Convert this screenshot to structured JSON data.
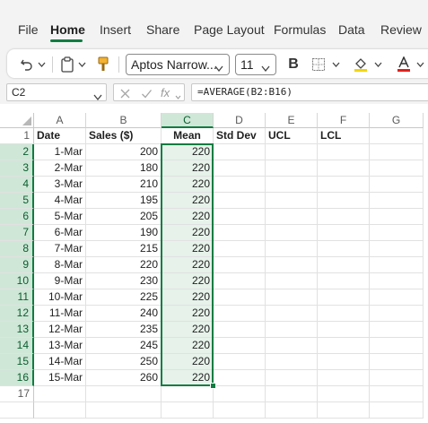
{
  "menu": {
    "tabs": [
      {
        "label": "File",
        "active": false
      },
      {
        "label": "Home",
        "active": true
      },
      {
        "label": "Insert",
        "active": false
      },
      {
        "label": "Share",
        "active": false
      },
      {
        "label": "Page Layout",
        "active": false
      },
      {
        "label": "Formulas",
        "active": false
      },
      {
        "label": "Data",
        "active": false
      },
      {
        "label": "Review",
        "active": false
      }
    ]
  },
  "ribbon": {
    "font_name": "Aptos Narrow...",
    "font_size": "11",
    "bold_label": "B",
    "icons": [
      "undo-icon",
      "clipboard-icon",
      "format-painter-icon",
      "borders-icon",
      "fill-color-icon",
      "font-color-icon"
    ],
    "fill_color": "#f2d600",
    "font_color": "#e0201b"
  },
  "formula_bar": {
    "name_box": "C2",
    "fx_label": "fx",
    "formula": "=AVERAGE(B2:B16)"
  },
  "sheet": {
    "active_cell": "C2",
    "column_letters": [
      "A",
      "B",
      "C",
      "D",
      "E",
      "F",
      "G"
    ],
    "active_column": "C",
    "headers": [
      "Date",
      "Sales ($)",
      "Mean",
      "Std Dev",
      "UCL",
      "LCL"
    ],
    "row_numbers": [
      "1",
      "2",
      "3",
      "4",
      "5",
      "6",
      "7",
      "8",
      "9",
      "10",
      "11",
      "12",
      "13",
      "14",
      "15",
      "16",
      "17"
    ],
    "rows": [
      {
        "date": "1-Mar",
        "sales": "200",
        "mean": "220"
      },
      {
        "date": "2-Mar",
        "sales": "180",
        "mean": "220"
      },
      {
        "date": "3-Mar",
        "sales": "210",
        "mean": "220"
      },
      {
        "date": "4-Mar",
        "sales": "195",
        "mean": "220"
      },
      {
        "date": "5-Mar",
        "sales": "205",
        "mean": "220"
      },
      {
        "date": "6-Mar",
        "sales": "190",
        "mean": "220"
      },
      {
        "date": "7-Mar",
        "sales": "215",
        "mean": "220"
      },
      {
        "date": "8-Mar",
        "sales": "220",
        "mean": "220"
      },
      {
        "date": "9-Mar",
        "sales": "230",
        "mean": "220"
      },
      {
        "date": "10-Mar",
        "sales": "225",
        "mean": "220"
      },
      {
        "date": "11-Mar",
        "sales": "240",
        "mean": "220"
      },
      {
        "date": "12-Mar",
        "sales": "235",
        "mean": "220"
      },
      {
        "date": "13-Mar",
        "sales": "245",
        "mean": "220"
      },
      {
        "date": "14-Mar",
        "sales": "250",
        "mean": "220"
      },
      {
        "date": "15-Mar",
        "sales": "260",
        "mean": "220"
      }
    ],
    "accent_color": "#107c41",
    "selection_fill": "#e6f2ea"
  }
}
